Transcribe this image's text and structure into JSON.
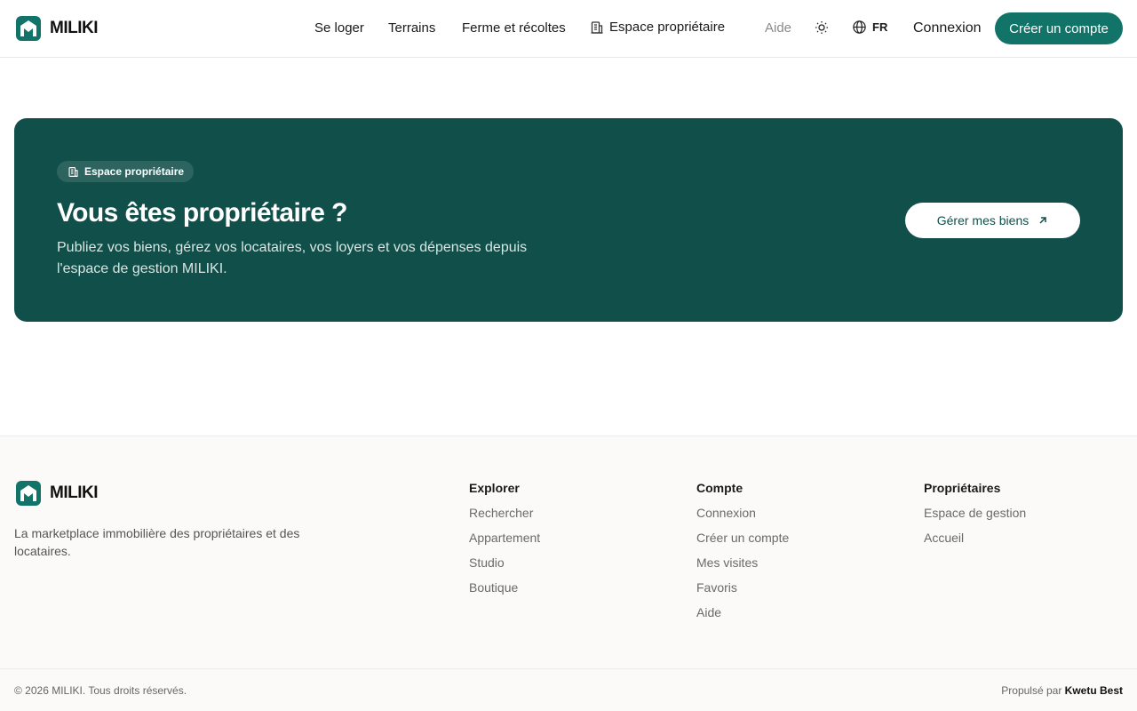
{
  "brand": {
    "name": "MILIKI",
    "color": "#127369"
  },
  "nav": {
    "items": [
      "Se loger",
      "Terrains",
      "Ferme et récoltes"
    ],
    "owner_space": "Espace propriétaire",
    "help": "Aide",
    "language": "FR",
    "login": "Connexion",
    "signup": "Créer un compte"
  },
  "banner": {
    "badge": "Espace propriétaire",
    "title": "Vous êtes propriétaire ?",
    "description": "Publiez vos biens, gérez vos locataires, vos loyers et vos dépenses depuis l'espace de gestion MILIKI.",
    "cta": "Gérer mes biens",
    "background": "#114f4b"
  },
  "footer": {
    "description": "La marketplace immobilière des propriétaires et des locataires.",
    "columns": [
      {
        "title": "Explorer",
        "links": [
          "Rechercher",
          "Appartement",
          "Studio",
          "Boutique"
        ]
      },
      {
        "title": "Compte",
        "links": [
          "Connexion",
          "Créer un compte",
          "Mes visites",
          "Favoris",
          "Aide"
        ]
      },
      {
        "title": "Propriétaires",
        "links": [
          "Espace de gestion",
          "Accueil"
        ]
      }
    ],
    "copyright": "© 2026 MILIKI. Tous droits réservés.",
    "powered_by_label": "Propulsé par",
    "powered_by_name": "Kwetu Best"
  },
  "icons": {
    "logo": "house-logo-icon",
    "owner": "building-icon",
    "theme": "sun-icon",
    "language": "globe-icon",
    "cta": "arrow-up-right-icon"
  }
}
